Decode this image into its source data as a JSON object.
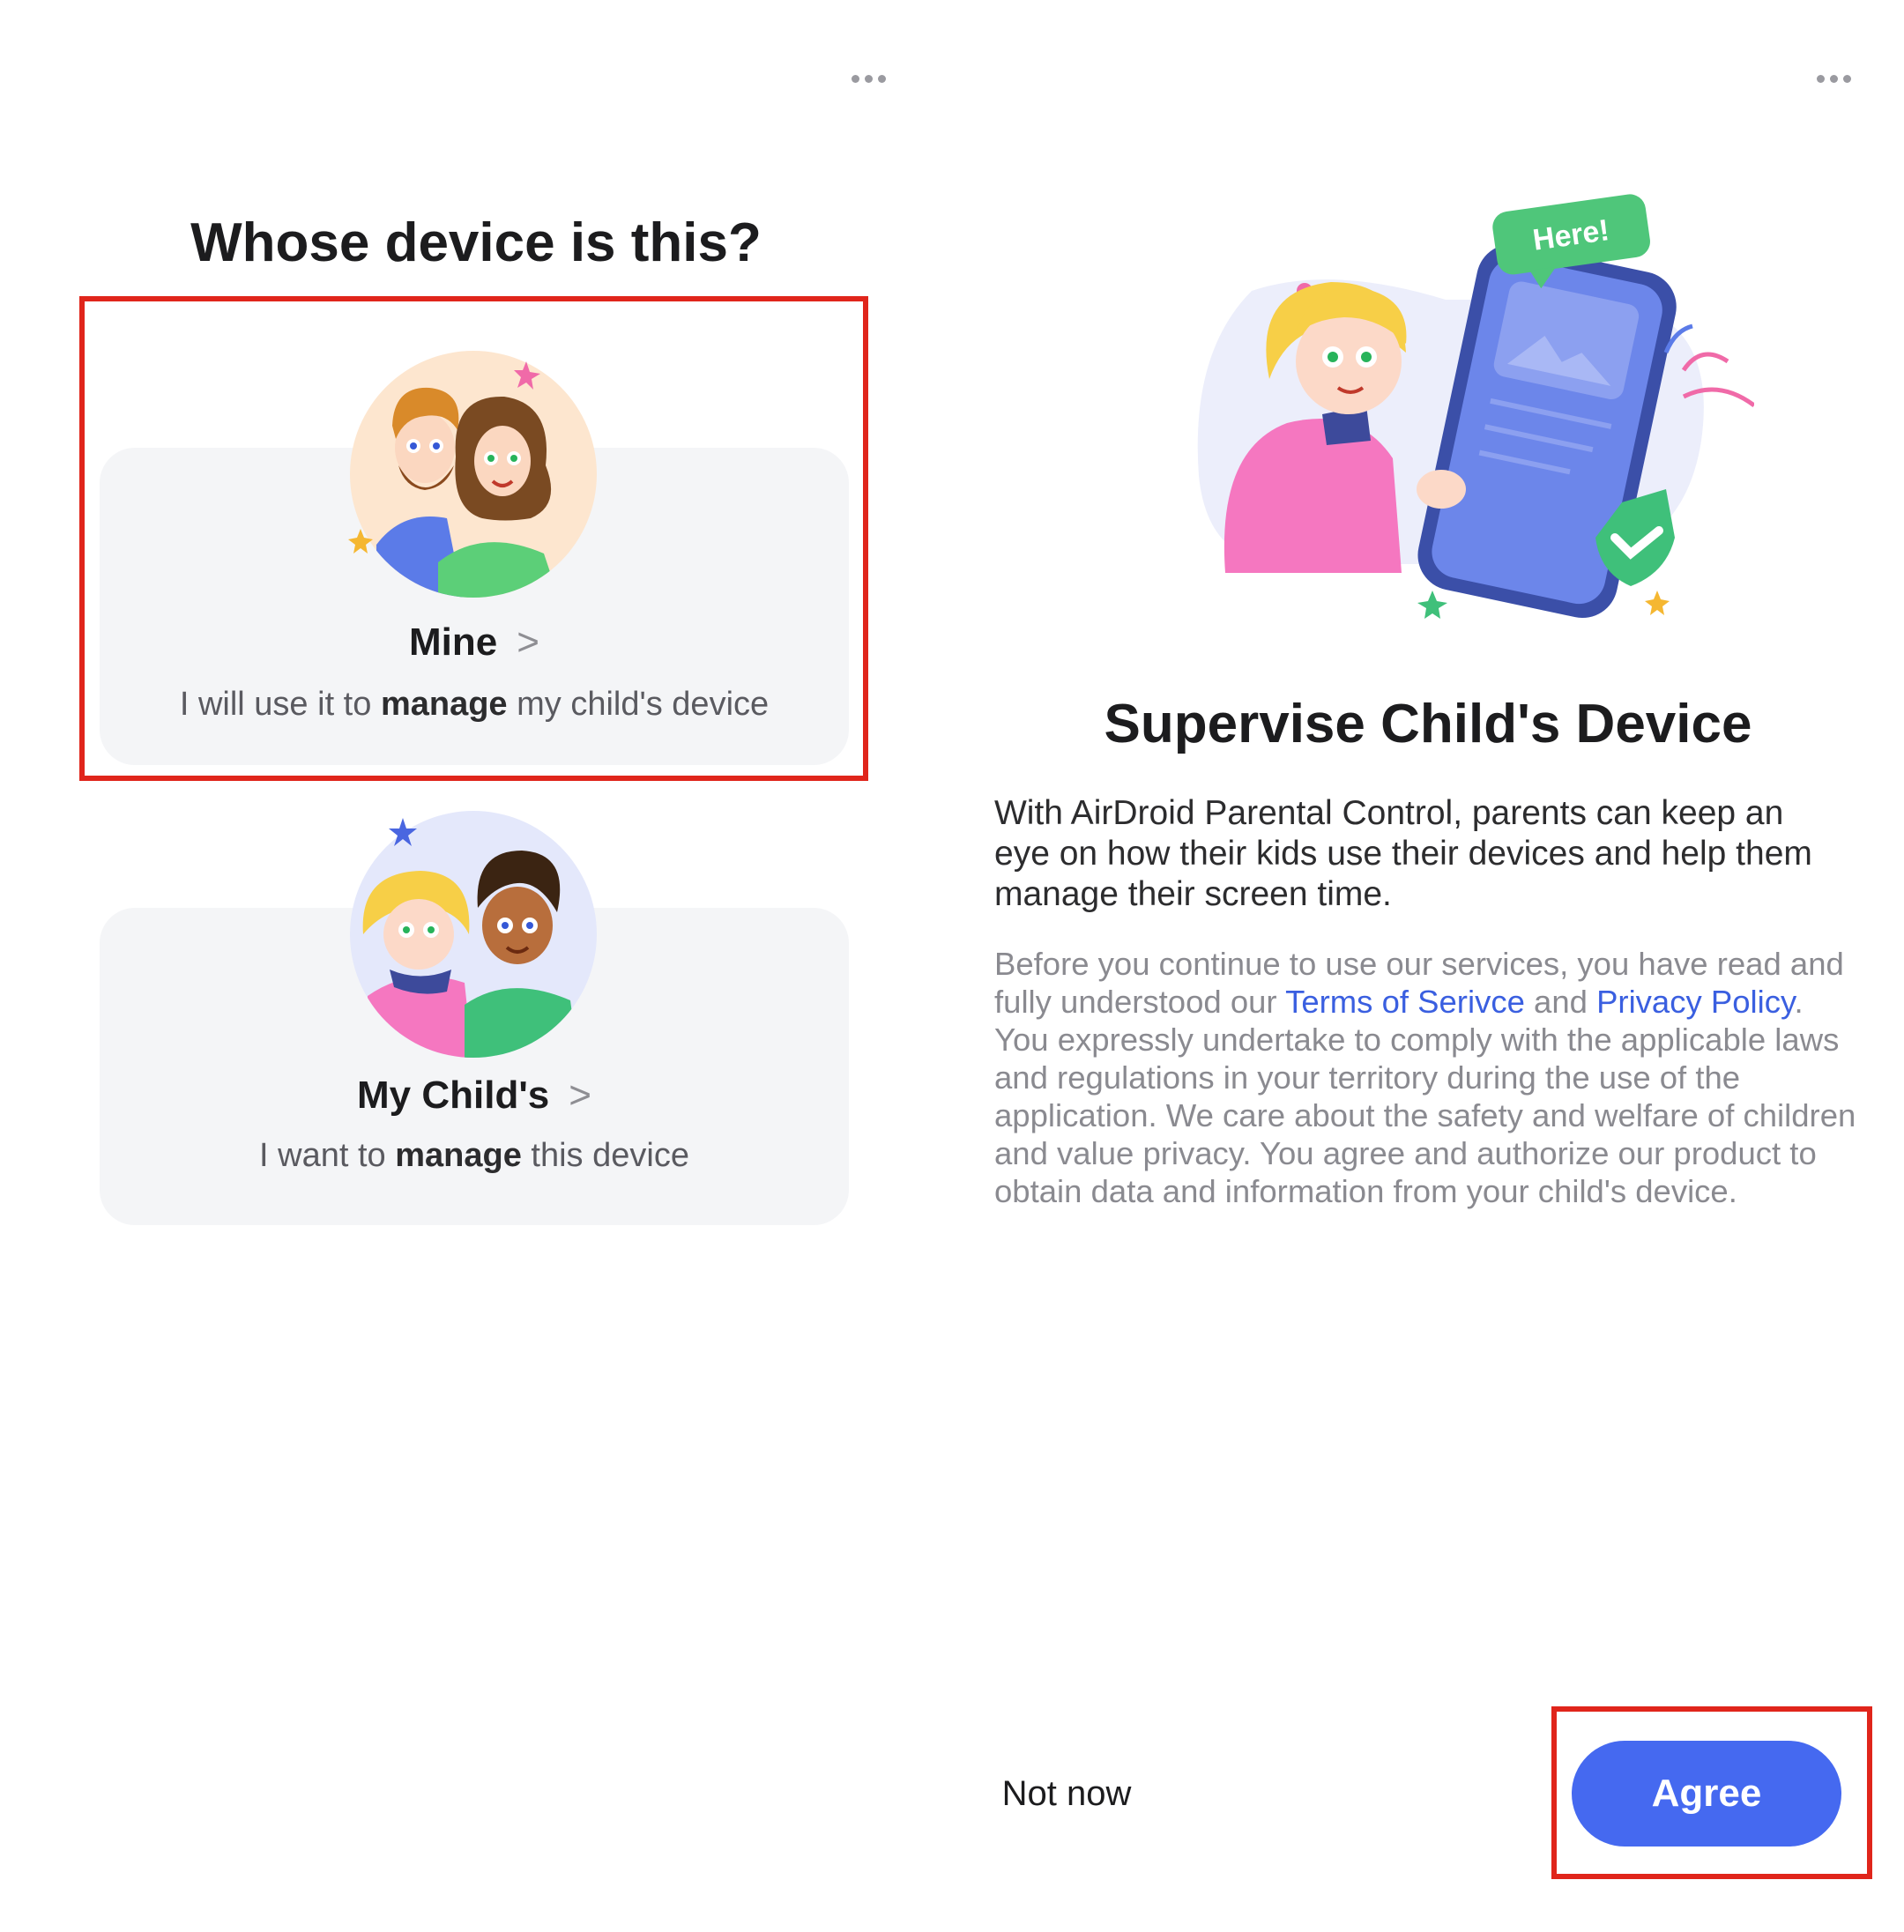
{
  "left_screen": {
    "menu_icon": "more-horizontal-icon",
    "heading": "Whose device is this?",
    "options": [
      {
        "title": "Mine",
        "chevron": ">",
        "desc_pre": "I will use it to ",
        "desc_bold": "manage",
        "desc_post": " my child's device",
        "illustration": "parents-illustration"
      },
      {
        "title": "My Child's",
        "chevron": ">",
        "desc_pre": "I want to ",
        "desc_bold": "manage",
        "desc_post": " this device",
        "illustration": "children-illustration"
      }
    ]
  },
  "right_screen": {
    "menu_icon": "more-horizontal-icon",
    "hero": {
      "bubble_text": "Here!",
      "illustration": "child-with-phone-illustration"
    },
    "title": "Supervise Child's Device",
    "intro": "With AirDroid Parental Control, parents can keep an eye on how their kids use their devices and help them manage their screen time.",
    "legal": {
      "part1": "Before you continue to use our services, you have read and fully understood our ",
      "terms_link": "Terms of Serivce",
      "part2": " and ",
      "privacy_link": "Privacy Policy",
      "part3": ". You expressly undertake to comply with the applicable laws and regulations in your territory during the use of the application. We care about the safety and welfare of children and value privacy. You agree and authorize our product to obtain data and information from your child's device."
    },
    "not_now_label": "Not now",
    "agree_label": "Agree"
  },
  "colors": {
    "accent": "#4569f0",
    "link": "#3a5fe0",
    "highlight": "#e0251b",
    "card_bg": "#f4f5f7"
  }
}
